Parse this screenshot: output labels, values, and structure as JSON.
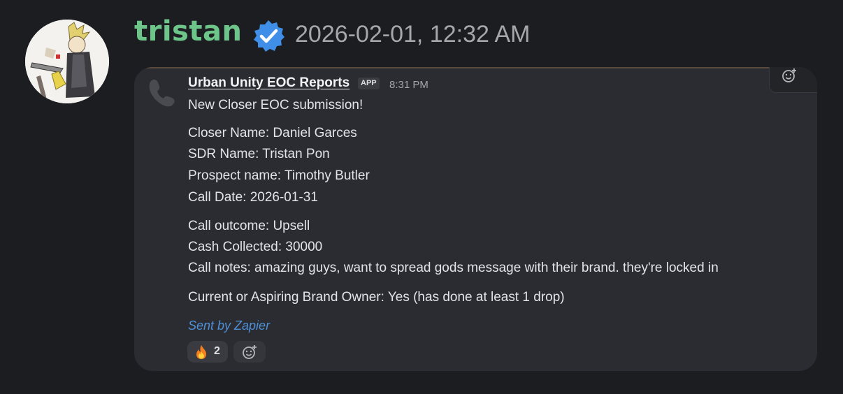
{
  "post": {
    "username": "tristan",
    "timestamp": "2026-02-01, 12:32 AM"
  },
  "embed": {
    "bot_name": "Urban Unity EOC Reports",
    "app_badge": "APP",
    "time": "8:31 PM",
    "lines": [
      "New Closer EOC submission!",
      "Closer Name: Daniel Garces",
      "SDR Name: Tristan Pon",
      "Prospect name: Timothy Butler",
      "Call Date: 2026-01-31",
      "Call outcome: Upsell",
      "Cash Collected: 30000",
      "Call notes: amazing guys, want to spread gods message with their brand. they're locked in",
      "Current or Aspiring Brand Owner: Yes (has done at least 1 drop)"
    ],
    "footer": "Sent by Zapier",
    "reaction": {
      "emoji": "fire-emoji",
      "count": "2"
    }
  },
  "colors": {
    "background": "#1c1d21",
    "card": "#2b2c31",
    "username": "#6dc58a",
    "verified": "#3f8ee8",
    "link": "#4f8fd6"
  }
}
